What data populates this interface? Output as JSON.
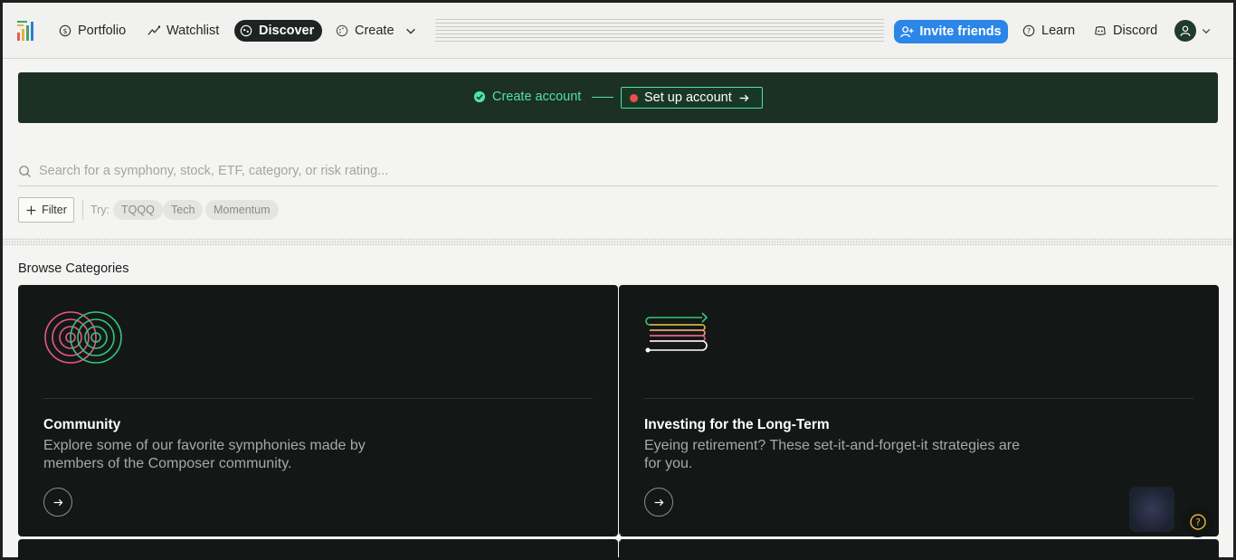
{
  "nav": {
    "portfolio": "Portfolio",
    "watchlist": "Watchlist",
    "discover": "Discover",
    "create": "Create",
    "invite": "Invite friends",
    "learn": "Learn",
    "discord": "Discord"
  },
  "banner": {
    "step_done": "Create account",
    "step_todo": "Set up account"
  },
  "search": {
    "placeholder": "Search for a symphony, stock, ETF, category, or risk rating..."
  },
  "filter": {
    "label": "Filter",
    "try_label": "Try:",
    "chips": [
      "TQQQ",
      "Tech",
      "Momentum"
    ]
  },
  "categories": {
    "title": "Browse Categories",
    "items": [
      {
        "title": "Community",
        "description": "Explore some of our favorite symphonies made by members of the Composer community."
      },
      {
        "title": "Investing for the Long-Term",
        "description": "Eyeing retirement? These set-it-and-forget-it strategies are for you."
      }
    ]
  },
  "colors": {
    "accent_blue": "#2b86e8",
    "banner_bg": "#1c3024",
    "success_green": "#4fe2a5",
    "card_bg": "#131817"
  }
}
